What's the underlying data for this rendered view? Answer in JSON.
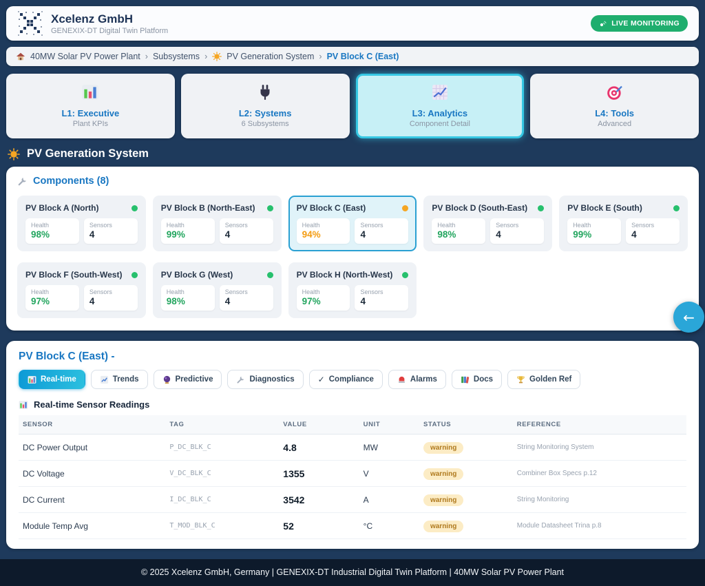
{
  "header": {
    "company": "Xcelenz GmbH",
    "subtitle": "GENEXIX-DT Digital Twin Platform",
    "live_badge": "LIVE MONITORING",
    "logo_icon": "pixel-x-logo",
    "live_icon": "satellite-icon"
  },
  "breadcrumb": {
    "separator": "›",
    "home_icon": "house-icon",
    "sun_icon": "sun-icon",
    "items": [
      {
        "label": "40MW Solar PV Power Plant"
      },
      {
        "label": "Subsystems"
      },
      {
        "label": "PV Generation System"
      },
      {
        "label": "PV Block C (East)"
      }
    ]
  },
  "level_tabs": [
    {
      "label": "L1: Executive",
      "sublabel": "Plant KPIs",
      "icon": "bar-chart-icon",
      "active": false
    },
    {
      "label": "L2: Systems",
      "sublabel": "6 Subsystems",
      "icon": "plug-icon",
      "active": false
    },
    {
      "label": "L3: Analytics",
      "sublabel": "Component Detail",
      "icon": "chart-increasing-icon",
      "active": true
    },
    {
      "label": "L4: Tools",
      "sublabel": "Advanced",
      "icon": "target-icon",
      "active": false
    }
  ],
  "section": {
    "title": "PV Generation System",
    "icon": "sun-icon"
  },
  "components": {
    "title": "Components (8)",
    "icon": "wrench-icon",
    "health_label": "Health",
    "sensors_label": "Sensors",
    "items": [
      {
        "name": "PV Block A (North)",
        "health": "98%",
        "sensors": "4",
        "status": "ok",
        "status_color": "#27c06d",
        "health_color": "#22a55e",
        "selected": false
      },
      {
        "name": "PV Block B (North-East)",
        "health": "99%",
        "sensors": "4",
        "status": "ok",
        "status_color": "#27c06d",
        "health_color": "#22a55e",
        "selected": false
      },
      {
        "name": "PV Block C (East)",
        "health": "94%",
        "sensors": "4",
        "status": "warning",
        "status_color": "#f5a623",
        "health_color": "#f39c12",
        "selected": true
      },
      {
        "name": "PV Block D (South-East)",
        "health": "98%",
        "sensors": "4",
        "status": "ok",
        "status_color": "#27c06d",
        "health_color": "#22a55e",
        "selected": false
      },
      {
        "name": "PV Block E (South)",
        "health": "99%",
        "sensors": "4",
        "status": "ok",
        "status_color": "#27c06d",
        "health_color": "#22a55e",
        "selected": false
      },
      {
        "name": "PV Block F (South-West)",
        "health": "97%",
        "sensors": "4",
        "status": "ok",
        "status_color": "#27c06d",
        "health_color": "#22a55e",
        "selected": false
      },
      {
        "name": "PV Block G (West)",
        "health": "98%",
        "sensors": "4",
        "status": "ok",
        "status_color": "#27c06d",
        "health_color": "#22a55e",
        "selected": false
      },
      {
        "name": "PV Block H (North-West)",
        "health": "97%",
        "sensors": "4",
        "status": "ok",
        "status_color": "#27c06d",
        "health_color": "#22a55e",
        "selected": false
      }
    ]
  },
  "detail": {
    "title": "PV Block C (East) -",
    "tabs": [
      {
        "label": "Real-time",
        "icon": "bar-chart-icon",
        "active": true
      },
      {
        "label": "Trends",
        "icon": "chart-increasing-icon",
        "active": false
      },
      {
        "label": "Predictive",
        "icon": "crystal-ball-icon",
        "active": false
      },
      {
        "label": "Diagnostics",
        "icon": "wrench-icon",
        "active": false
      },
      {
        "label": "Compliance",
        "icon": "check-icon",
        "active": false
      },
      {
        "label": "Alarms",
        "icon": "alarm-light-icon",
        "active": false
      },
      {
        "label": "Docs",
        "icon": "books-icon",
        "active": false
      },
      {
        "label": "Golden Ref",
        "icon": "trophy-icon",
        "active": false
      }
    ],
    "check_glyph": "✓",
    "table": {
      "title": "Real-time Sensor Readings",
      "icon": "bar-chart-icon",
      "columns": [
        "SENSOR",
        "TAG",
        "VALUE",
        "UNIT",
        "STATUS",
        "REFERENCE"
      ],
      "rows": [
        {
          "sensor": "DC Power Output",
          "tag": "P_DC_BLK_C",
          "value": "4.8",
          "unit": "MW",
          "status": "warning",
          "reference": "String Monitoring System"
        },
        {
          "sensor": "DC Voltage",
          "tag": "V_DC_BLK_C",
          "value": "1355",
          "unit": "V",
          "status": "warning",
          "reference": "Combiner Box Specs p.12"
        },
        {
          "sensor": "DC Current",
          "tag": "I_DC_BLK_C",
          "value": "3542",
          "unit": "A",
          "status": "warning",
          "reference": "String Monitoring"
        },
        {
          "sensor": "Module Temp Avg",
          "tag": "T_MOD_BLK_C",
          "value": "52",
          "unit": "°C",
          "status": "warning",
          "reference": "Module Datasheet Trina p.8"
        }
      ]
    }
  },
  "back_button": {
    "glyph": "←",
    "icon": "left-arrow-icon"
  },
  "footer": {
    "text": "© 2025 Xcelenz GmbH, Germany | GENEXIX-DT Industrial Digital Twin Platform | 40MW Solar PV Power Plant"
  },
  "colors": {
    "page_bg": "#1e3a5c",
    "accent_blue": "#1977c2",
    "selected_cyan_bg": "#c7f0f6",
    "selected_cyan_border": "#35c7e3",
    "green": "#22a55e",
    "orange": "#f39c12",
    "status_dot_green": "#27c06d",
    "status_dot_orange": "#f5a623",
    "warning_badge_bg": "#fcecc5",
    "warning_badge_text": "#b07a1e",
    "live_badge_bg": "#1fae6e",
    "footer_bg": "#0d1a2b",
    "back_button_bg": "#2aa6d8"
  }
}
